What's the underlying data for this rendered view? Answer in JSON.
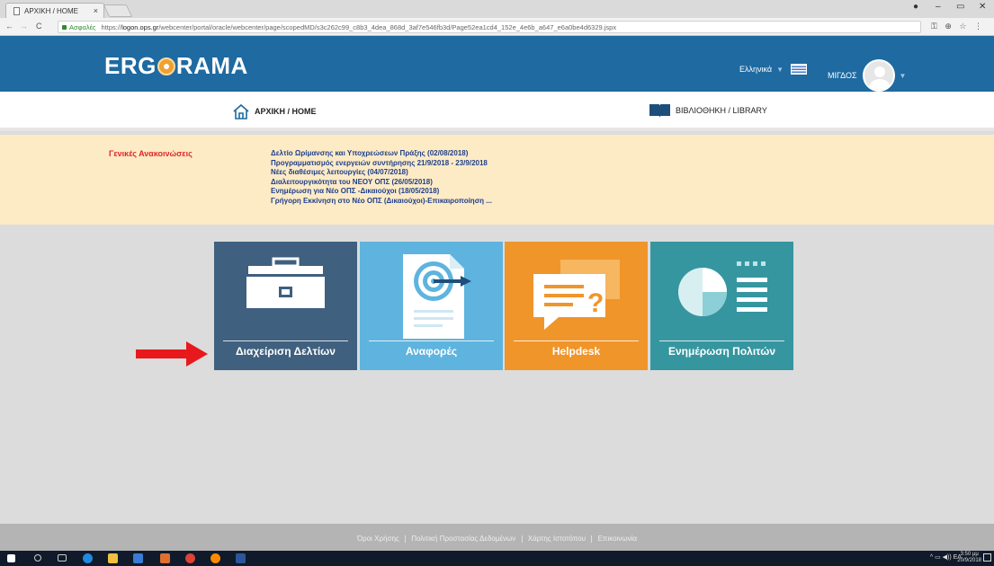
{
  "browser": {
    "tab_title": "ΑΡΧΙΚΗ / HOME",
    "tab_close": "×",
    "secure_label": "Ασφαλές",
    "url_prefix": "https://",
    "url_host": "logon.ops.gr",
    "url_path": "/webcenter/portal/oracle/webcenter/page/scopedMD/s3c262c99_c8b3_4dea_868d_3af7e546fb3d/Page52ea1cd4_152e_4e6b_a647_e6a0be4d6329.jspx",
    "back": "←",
    "forward": "→",
    "reload": "C"
  },
  "header": {
    "logo_left": "ERG",
    "logo_right": "RAMA",
    "language": "Ελληνικά",
    "user_name": "ΜΙΓΔΟΣ"
  },
  "nav": {
    "home_label": "ΑΡΧΙΚΗ / HOME",
    "library_label": "ΒΙΒΛΙΟΘΗΚΗ / LIBRARY"
  },
  "announcements": {
    "title": "Γενικές Ανακοινώσεις",
    "items": [
      "Δελτίο Ωρίμανσης και Υποχρεώσεων Πράξης (02/08/2018)",
      "Προγραμματισμός ενεργειών συντήρησης 21/9/2018 - 23/9/2018",
      "Νέες διαθέσιμες λειτουργίες (04/07/2018)",
      "Διαλειτουργικότητα του ΝΕΟΥ ΟΠΣ (26/05/2018)",
      "Ενημέρωση για Νέο ΟΠΣ -Δικαιούχοι (18/05/2018)",
      "Γρήγορη Εκκίνηση στο Νέο ΟΠΣ (Δικαιούχοι)-Επικαιροποίηση ..."
    ]
  },
  "tiles": [
    {
      "label": "Διαχείριση Δελτίων",
      "icon": "briefcase-icon",
      "color": "#3f607e"
    },
    {
      "label": "Αναφορές",
      "icon": "report-target-icon",
      "color": "#5eb4de"
    },
    {
      "label": "Helpdesk",
      "icon": "chat-question-icon",
      "color": "#f0952a"
    },
    {
      "label": "Ενημέρωση Πολιτών",
      "icon": "pie-chart-list-icon",
      "color": "#3596a0"
    }
  ],
  "footer": {
    "links": [
      "Όροι Χρήσης",
      "Πολιτική Προστασίας Δεδομένων",
      "Χάρτης Ιστοτόπου",
      "Επικοινωνία"
    ]
  },
  "taskbar": {
    "tray_lang": "ΕΛ",
    "clock_time": "3:50 μμ",
    "clock_date": "20/9/2018"
  },
  "colors": {
    "header_blue": "#1e6aa1",
    "announce_bg": "#fdebc6",
    "announce_title": "#e0262a",
    "arrow": "#e8191c"
  }
}
